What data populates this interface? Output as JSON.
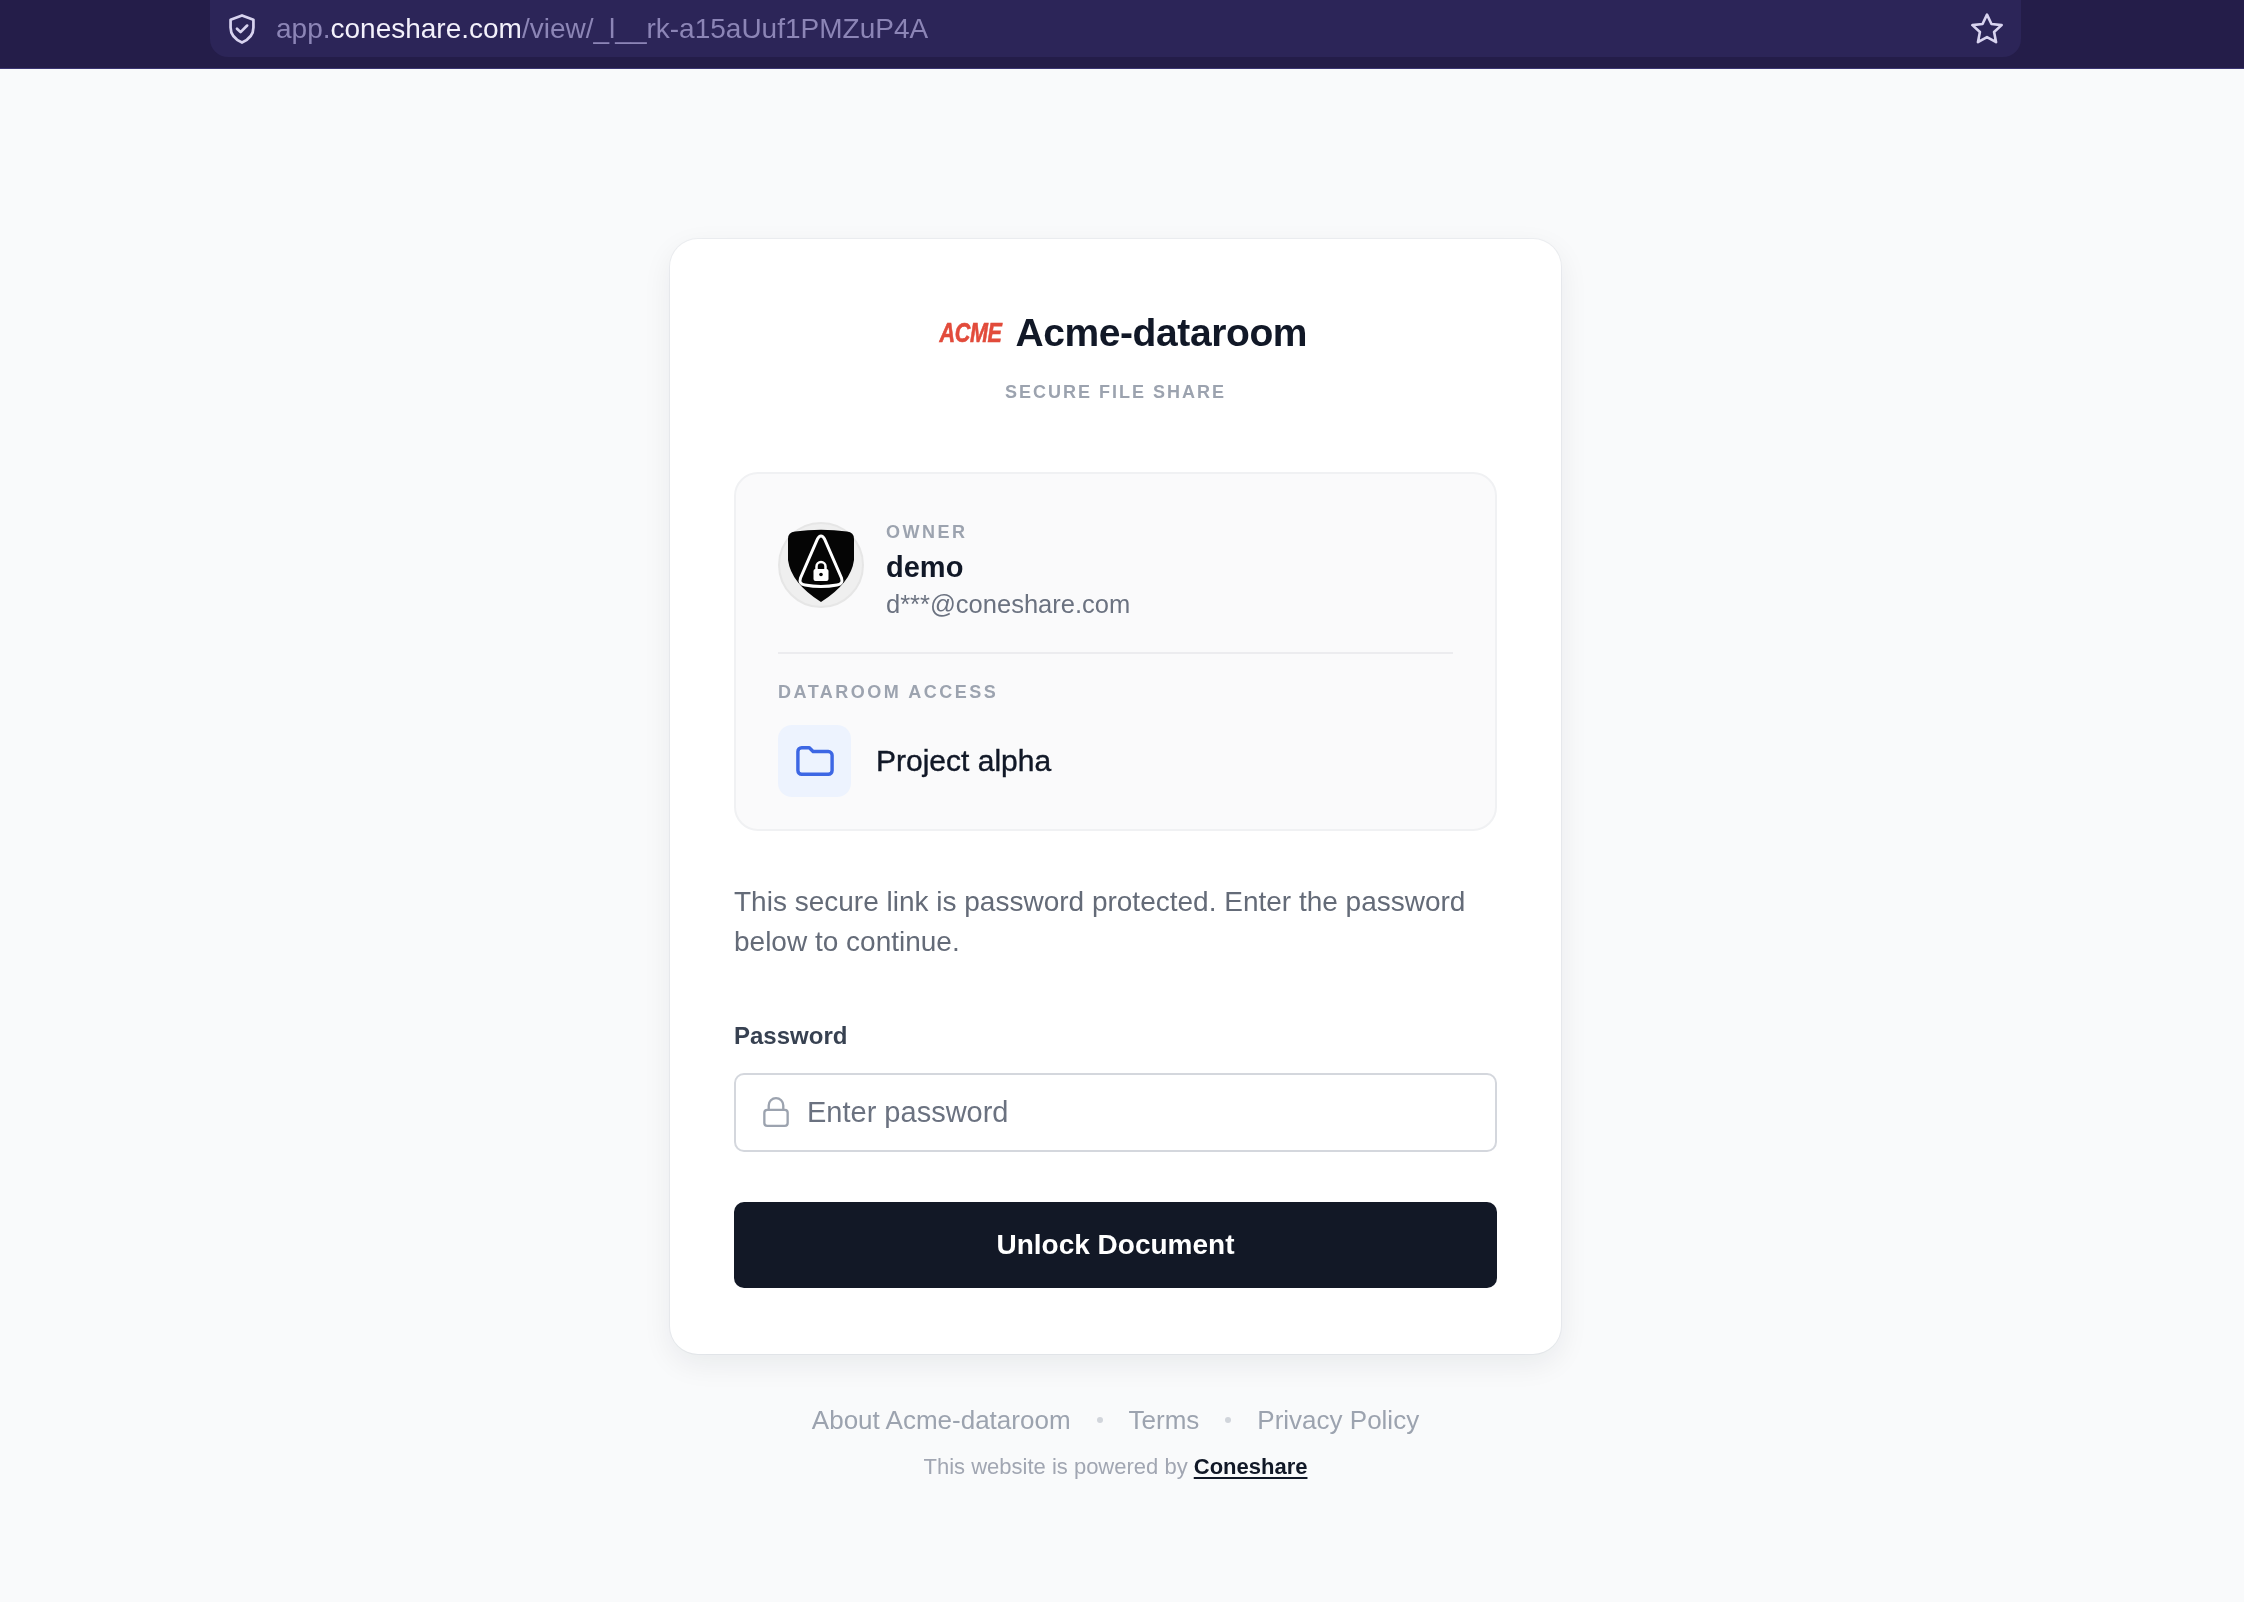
{
  "browser_bar": {
    "url_parts": [
      {
        "text": "app.",
        "emphasized": false
      },
      {
        "text": "coneshare.com",
        "emphasized": true
      },
      {
        "text": "/view/_l__rk-a15aUuf1PMZuP4A",
        "emphasized": false
      }
    ]
  },
  "header": {
    "logo_text": "ACME",
    "title": "Acme-dataroom",
    "subtitle": "SECURE FILE SHARE"
  },
  "owner_panel": {
    "owner_label": "OWNER",
    "name": "demo",
    "email": "d***@coneshare.com",
    "access_label": "DATAROOM ACCESS",
    "dataroom": "Project alpha"
  },
  "message": "This secure link is password protected. Enter the password below to continue.",
  "password_field": {
    "label": "Password",
    "placeholder": "Enter password"
  },
  "unlock_button": "Unlock Document",
  "footer": {
    "links": [
      "About Acme-dataroom",
      "Terms",
      "Privacy Policy"
    ],
    "powered_by": "This website is powered by",
    "powered_link": "Coneshare"
  }
}
